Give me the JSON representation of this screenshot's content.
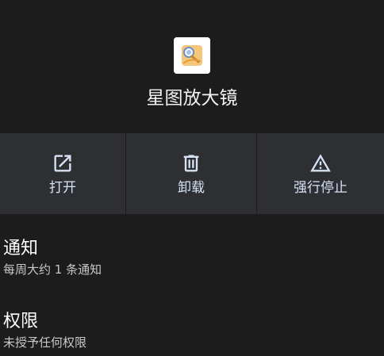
{
  "app": {
    "name": "星图放大镜",
    "icon": "magnifier-app-icon"
  },
  "actions": [
    {
      "label": "打开",
      "icon": "open-external-icon"
    },
    {
      "label": "卸载",
      "icon": "trash-icon"
    },
    {
      "label": "强行停止",
      "icon": "warning-icon"
    }
  ],
  "sections": {
    "notifications": {
      "title": "通知",
      "summary": "每周大约 1 条通知"
    },
    "permissions": {
      "title": "权限",
      "summary": "未授予任何权限"
    }
  },
  "colors": {
    "background": "#1c1c1c",
    "action_bg": "#2d2f33",
    "action_text": "#d7e2f5"
  }
}
